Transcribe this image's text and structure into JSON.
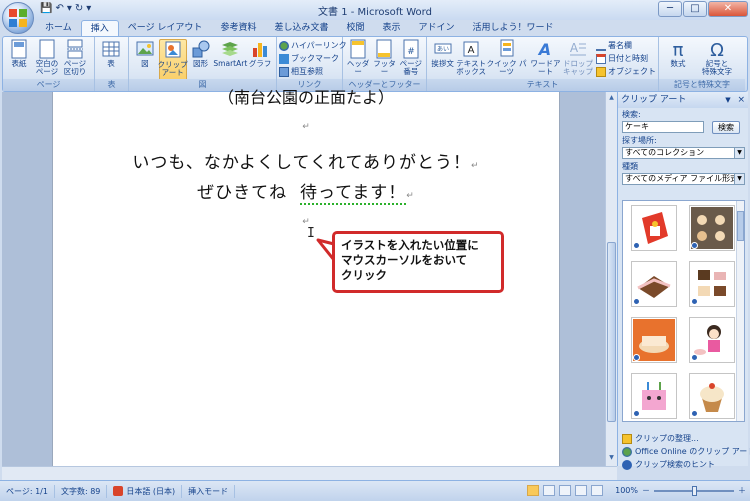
{
  "window": {
    "title": "文書 1 - Microsoft Word",
    "controls": {
      "minimize": "─",
      "maximize": "□",
      "close": "✕"
    }
  },
  "qat": {
    "save": "💾",
    "undo": "↶",
    "undo_arrow": "▾",
    "redo": "↻",
    "customize": "▾"
  },
  "tabs": [
    {
      "label": "ホーム"
    },
    {
      "label": "挿入"
    },
    {
      "label": "ページ レイアウト"
    },
    {
      "label": "参考資料"
    },
    {
      "label": "差し込み文書"
    },
    {
      "label": "校閲"
    },
    {
      "label": "表示"
    },
    {
      "label": "アドイン"
    },
    {
      "label": "活用しよう！ワード"
    }
  ],
  "ribbon": {
    "page_group": {
      "label": "ページ",
      "cover": "表紙",
      "blank": "空白の\nページ",
      "break": "ページ\n区切り"
    },
    "table_group": {
      "label": "表",
      "table": "表"
    },
    "illus_group": {
      "label": "図",
      "picture": "図",
      "clipart": "クリップ\nアート",
      "shapes": "図形",
      "smartart": "SmartArt",
      "chart": "グラフ"
    },
    "link_group": {
      "label": "リンク",
      "hyperlink": "ハイパーリンク",
      "bookmark": "ブックマーク",
      "crossref": "相互参照"
    },
    "hf_group": {
      "label": "ヘッダーとフッター",
      "header": "ヘッダー",
      "footer": "フッター",
      "pagenum": "ページ\n番号"
    },
    "text_group": {
      "label": "テキスト",
      "greeting": "挨拶文",
      "textbox": "テキスト\nボックス",
      "quickparts": "クイック パーツ",
      "wordart": "ワードアート",
      "dropcap": "ドロップ\nキャップ",
      "signature": "署名欄",
      "datetime": "日付と時刻",
      "object": "オブジェクト"
    },
    "symbol_group": {
      "label": "記号と特殊文字",
      "equation": "数式",
      "symbol": "記号と\n特殊文字"
    }
  },
  "document": {
    "line0": "（南台公園の正面たよ）",
    "line1": "いつも、なかよくしてくれてありがとう！",
    "line2a": "ぜひきてね",
    "line2b": "待ってます！",
    "para_mark": "↵",
    "ibeam": "I"
  },
  "callout": {
    "text_line1": "イラストを入れたい位置に",
    "text_line2": "マウスカーソルをおいて",
    "text_line3": "クリック"
  },
  "clip_pane": {
    "title": "クリップ アート",
    "close": "×",
    "dropdown": "▼",
    "search_label": "検索:",
    "search_value": "ケーキ",
    "search_button": "検索",
    "location_label": "探す場所:",
    "location_value": "すべてのコレクション",
    "type_label": "種類",
    "type_value": "すべてのメディア ファイル形式",
    "links": [
      {
        "label": "クリップの整理..."
      },
      {
        "label": "Office Online のクリップ アート"
      },
      {
        "label": "クリップ検索のヒント"
      }
    ]
  },
  "status": {
    "page": "ページ: 1/1",
    "words": "文字数: 89",
    "language": "日本語 (日本)",
    "mode": "挿入モード",
    "zoom": "100%",
    "zoom_minus": "－",
    "zoom_plus": "＋"
  },
  "colors": {
    "accent": "#15428b",
    "callout_border": "#d12a2a",
    "ribbon_bg": "#dbe6f4"
  }
}
